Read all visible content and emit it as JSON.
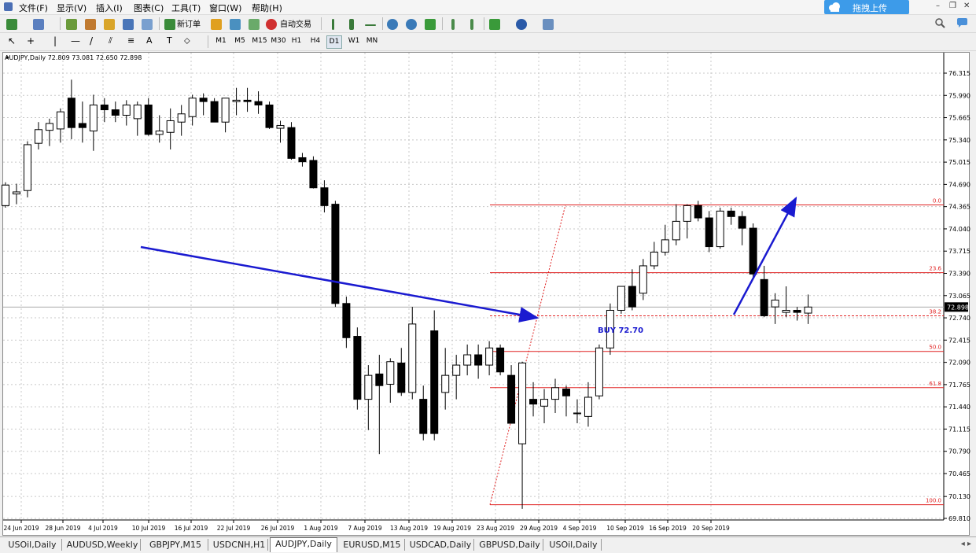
{
  "menu": [
    "文件(F)",
    "显示(V)",
    "插入(I)",
    "图表(C)",
    "工具(T)",
    "窗口(W)",
    "帮助(H)"
  ],
  "upload_label": "拖拽上传",
  "toolbar": {
    "new_order": "新订单",
    "auto_trade": "自动交易"
  },
  "timeframes": [
    "M1",
    "M5",
    "M15",
    "M30",
    "H1",
    "H4",
    "D1",
    "W1",
    "MN"
  ],
  "active_timeframe": "D1",
  "chart_header": "AUDJPY,Daily  72.809 73.081 72.650 72.898",
  "price_labels": [
    "76.315",
    "75.990",
    "75.665",
    "75.340",
    "75.015",
    "74.690",
    "74.365",
    "74.040",
    "73.715",
    "73.390",
    "73.065",
    "72.740",
    "72.415",
    "72.090",
    "71.765",
    "71.440",
    "71.115",
    "70.790",
    "70.465",
    "70.130",
    "69.810"
  ],
  "current_price": "72.898",
  "date_labels": [
    "24 Jun 2019",
    "28 Jun 2019",
    "4 Jul 2019",
    "10 Jul 2019",
    "16 Jul 2019",
    "22 Jul 2019",
    "26 Jul 2019",
    "1 Aug 2019",
    "7 Aug 2019",
    "13 Aug 2019",
    "19 Aug 2019",
    "23 Aug 2019",
    "29 Aug 2019",
    "4 Sep 2019",
    "10 Sep 2019",
    "16 Sep 2019",
    "20 Sep 2019"
  ],
  "fib_levels": [
    {
      "label": "0.0",
      "price": 74.39
    },
    {
      "label": "23.6",
      "price": 73.4
    },
    {
      "label": "38.2",
      "price": 72.77
    },
    {
      "label": "50.0",
      "price": 72.25
    },
    {
      "label": "61.8",
      "price": 71.72
    },
    {
      "label": "100.0",
      "price": 70.01
    }
  ],
  "annotation": "BUY 72.70",
  "tabs": [
    "USOil,Daily",
    "AUDUSD,Weekly",
    "GBPJPY,M15",
    "USDCNH,H1",
    "AUDJPY,Daily",
    "EURUSD,M15",
    "USDCAD,Daily",
    "GBPUSD,Daily",
    "USOil,Daily"
  ],
  "active_tab": "AUDJPY,Daily",
  "colors": {
    "candle": "#000000",
    "fib": "#e02020",
    "arrow": "#1a1ad0",
    "grid": "#c8c8c8",
    "upload": "#3d9be9"
  },
  "chart_data": {
    "type": "candlestick",
    "symbol": "AUDJPY",
    "timeframe": "Daily",
    "ylim": [
      69.81,
      76.315
    ],
    "candles": [
      [
        74.38,
        74.72,
        74.35,
        74.68
      ],
      [
        74.55,
        74.7,
        74.4,
        74.58
      ],
      [
        74.6,
        75.32,
        74.5,
        75.27
      ],
      [
        75.29,
        75.6,
        75.2,
        75.49
      ],
      [
        75.48,
        75.65,
        75.25,
        75.58
      ],
      [
        75.5,
        75.8,
        75.3,
        75.75
      ],
      [
        75.95,
        76.22,
        75.35,
        75.52
      ],
      [
        75.58,
        75.9,
        75.3,
        75.52
      ],
      [
        75.47,
        76.0,
        75.18,
        75.85
      ],
      [
        75.85,
        75.95,
        75.6,
        75.78
      ],
      [
        75.78,
        75.9,
        75.6,
        75.7
      ],
      [
        75.7,
        75.92,
        75.55,
        75.85
      ],
      [
        75.65,
        75.9,
        75.4,
        75.85
      ],
      [
        75.85,
        75.95,
        75.4,
        75.42
      ],
      [
        75.42,
        75.7,
        75.3,
        75.47
      ],
      [
        75.45,
        75.8,
        75.2,
        75.62
      ],
      [
        75.6,
        75.85,
        75.4,
        75.72
      ],
      [
        75.68,
        76.0,
        75.55,
        75.95
      ],
      [
        75.95,
        76.02,
        75.7,
        75.9
      ],
      [
        75.9,
        75.95,
        75.6,
        75.6
      ],
      [
        75.6,
        75.95,
        75.45,
        75.95
      ],
      [
        75.9,
        76.1,
        75.7,
        75.92
      ],
      [
        75.92,
        76.1,
        75.75,
        75.9
      ],
      [
        75.9,
        76.05,
        75.72,
        75.85
      ],
      [
        75.85,
        75.9,
        75.5,
        75.52
      ],
      [
        75.51,
        75.62,
        75.3,
        75.55
      ],
      [
        75.52,
        75.6,
        75.05,
        75.07
      ],
      [
        75.08,
        75.15,
        74.95,
        75.02
      ],
      [
        75.04,
        75.1,
        74.63,
        74.64
      ],
      [
        74.64,
        74.75,
        74.28,
        74.38
      ],
      [
        74.4,
        74.45,
        72.9,
        72.95
      ],
      [
        72.95,
        73.05,
        72.3,
        72.45
      ],
      [
        72.47,
        72.6,
        71.4,
        71.55
      ],
      [
        71.55,
        72.05,
        71.1,
        71.9
      ],
      [
        71.92,
        72.2,
        70.75,
        71.75
      ],
      [
        71.77,
        72.15,
        71.5,
        72.1
      ],
      [
        72.08,
        72.3,
        71.6,
        71.65
      ],
      [
        71.65,
        72.9,
        71.55,
        72.65
      ],
      [
        71.55,
        71.75,
        70.95,
        71.05
      ],
      [
        72.55,
        72.85,
        70.95,
        71.05
      ],
      [
        71.65,
        72.3,
        71.4,
        71.9
      ],
      [
        71.9,
        72.2,
        71.55,
        72.05
      ],
      [
        72.05,
        72.35,
        71.9,
        72.2
      ],
      [
        72.2,
        72.35,
        71.85,
        72.05
      ],
      [
        72.05,
        72.4,
        71.9,
        72.3
      ],
      [
        72.3,
        72.35,
        71.9,
        71.95
      ],
      [
        71.9,
        72.05,
        71.2,
        71.2
      ],
      [
        70.9,
        72.1,
        69.95,
        72.08
      ],
      [
        71.55,
        71.8,
        71.3,
        71.48
      ],
      [
        71.45,
        71.7,
        71.2,
        71.55
      ],
      [
        71.55,
        71.85,
        71.35,
        71.72
      ],
      [
        71.7,
        71.75,
        71.3,
        71.6
      ],
      [
        71.35,
        71.55,
        71.2,
        71.35
      ],
      [
        71.3,
        71.8,
        71.15,
        71.58
      ],
      [
        71.6,
        72.35,
        71.55,
        72.3
      ],
      [
        72.3,
        72.95,
        72.2,
        72.85
      ],
      [
        72.85,
        73.2,
        72.8,
        73.2
      ],
      [
        73.2,
        73.45,
        72.85,
        72.9
      ],
      [
        73.1,
        73.6,
        73.0,
        73.5
      ],
      [
        73.5,
        73.85,
        73.45,
        73.7
      ],
      [
        73.7,
        74.1,
        73.65,
        73.88
      ],
      [
        73.88,
        74.4,
        73.8,
        74.15
      ],
      [
        74.15,
        74.4,
        73.9,
        74.38
      ],
      [
        74.38,
        74.45,
        74.15,
        74.2
      ],
      [
        74.2,
        74.3,
        73.7,
        73.78
      ],
      [
        73.78,
        74.35,
        73.75,
        74.3
      ],
      [
        74.3,
        74.35,
        74.1,
        74.22
      ],
      [
        74.22,
        74.3,
        73.8,
        74.05
      ],
      [
        74.05,
        74.12,
        73.3,
        73.38
      ],
      [
        73.3,
        73.5,
        72.75,
        72.77
      ],
      [
        72.9,
        73.1,
        72.65,
        73.0
      ],
      [
        72.82,
        73.2,
        72.75,
        72.85
      ],
      [
        72.85,
        72.9,
        72.7,
        72.82
      ],
      [
        72.809,
        73.081,
        72.65,
        72.898
      ]
    ],
    "annotations": {
      "buy_label": "BUY 72.70",
      "fibonacci": {
        "high": 74.39,
        "low": 70.01
      }
    }
  }
}
